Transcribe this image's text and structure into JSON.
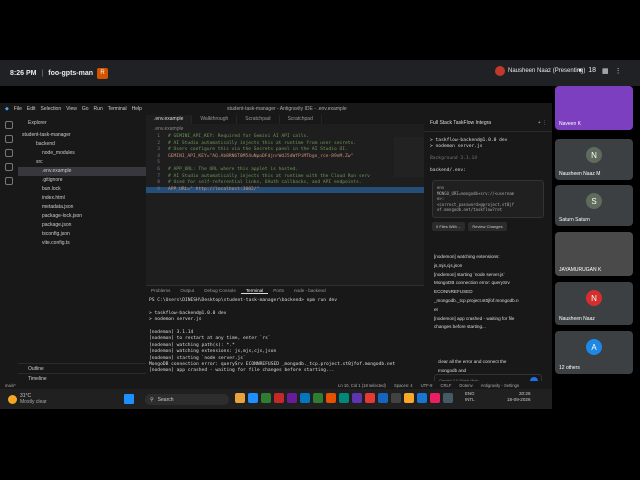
{
  "meet": {
    "time": "8:26 PM",
    "separator": "|",
    "meeting_title": "foo-gpts-man",
    "presenter_initials": "R",
    "presenter": "Nausheen Naaz (Presenting)",
    "participants_count": "18"
  },
  "ide": {
    "menu": [
      "File",
      "Edit",
      "Selection",
      "View",
      "Go",
      "Run",
      "Terminal",
      "Help"
    ],
    "window_title": "student-task-manager - Antigravity IDE - .env.example",
    "explorer_header": "Explorer",
    "project": "student-task-manager",
    "tree": [
      {
        "label": "backend",
        "level": 1,
        "selected": false
      },
      {
        "label": "node_modules",
        "level": 2,
        "selected": false
      },
      {
        "label": "src",
        "level": 1,
        "selected": false
      },
      {
        "label": ".env.example",
        "level": 2,
        "selected": true
      },
      {
        "label": ".gitignore",
        "level": 2,
        "selected": false
      },
      {
        "label": "bun.lock",
        "level": 2,
        "selected": false
      },
      {
        "label": "index.html",
        "level": 2,
        "selected": false
      },
      {
        "label": "metadata.json",
        "level": 2,
        "selected": false
      },
      {
        "label": "package-lock.json",
        "level": 2,
        "selected": false
      },
      {
        "label": "package.json",
        "level": 2,
        "selected": false
      },
      {
        "label": "tsconfig.json",
        "level": 2,
        "selected": false
      },
      {
        "label": "vite.config.ts",
        "level": 2,
        "selected": false
      }
    ],
    "outline": "Outline",
    "timeline": "Timeline",
    "tabs": [
      ".env.example",
      "Walkthrough",
      "Scratchpad",
      "Scratchpad"
    ],
    "breadcrumb": ".env.example",
    "code": [
      {
        "n": "1",
        "t": "# GEMINI_API_KEY: Required for Gemini AI API calls.",
        "c": "cm"
      },
      {
        "n": "2",
        "t": "# AI Studio automatically injects this at runtime from user secrets.",
        "c": "cm"
      },
      {
        "n": "3",
        "t": "# Users configure this via the Secrets panel in the AI Studio UI.",
        "c": "cm"
      },
      {
        "n": "4",
        "t": "GEMINI_API_KEY=\"AQ.Ab8RN6T0M54uNpoDFdjnrWdJ5dWfPiMTbgn_rce-89eM.Zw\"",
        "c": "st"
      },
      {
        "n": "5",
        "t": "",
        "c": ""
      },
      {
        "n": "6",
        "t": "# APP_URL: The URL where this applet is hosted.",
        "c": "cm"
      },
      {
        "n": "7",
        "t": "# AI Studio automatically injects this at runtime with the Cloud Run serv",
        "c": "cm"
      },
      {
        "n": "8",
        "t": "# Used for self-referential links, OAuth callbacks, and API endpoints.",
        "c": "cm"
      },
      {
        "n": "9",
        "t": "APP_URL=\" http://localhost:3002/\"",
        "c": "st"
      }
    ],
    "panel_tabs": [
      "Problems",
      "Output",
      "Debug Console",
      "Terminal",
      "Ports",
      "node - backend"
    ],
    "terminal": "PS C:\\Users\\DINESH\\Desktop\\student-task-manager\\backend> npm run dev\n\n> taskflow-backend@1.0.0 dev\n> nodemon server.js\n\n[nodemon] 3.1.14\n[nodemon] to restart at any time, enter `rs`\n[nodemon] watching path(s): *.*\n[nodemon] watching extensions: js,mjs,cjs,json\n[nodemon] starting `node server.js`\nMongoDB connection error: querySrv ECONNREFUSED _mongodb._tcp.project.st0jfof.mongodb.net\n[nodemon] app crashed - waiting for file changes before starting...",
    "status_left": "main*",
    "status_right": [
      "Ln 10, Col 1 (18 selected)",
      "Spaces: 4",
      "UTF-8",
      "CRLF",
      "Dotenv",
      "Antigravity - Settings"
    ]
  },
  "agent": {
    "title": "Full Stack TaskFlow Integra",
    "term_lines": [
      "> taskflow-backend@1.0.0 dev",
      "> nodemon server.js"
    ],
    "status_text": "Background 3.1.14",
    "cwd": "backend/.env:",
    "card_lines": [
      "env",
      "MONGO_URI=mongodb+srv://<usernam",
      "e>:",
      "<correct_password>@project.st0jf",
      "of.mongodb.net/taskflow?ret"
    ],
    "btn_files": "0 Files With ...",
    "btn_review": "Review Changes",
    "log": [
      "[nodemon] watching extensions:",
      "js,mjs,cjs,json",
      "[nodemon] starting `node server.js`",
      "MongoDB connection error: querySrv",
      "ECONNREFUSED",
      "_mongodb._tcp.project.st0jfof.mongodb.n",
      "et",
      "[nodemon] app crashed - waiting for file",
      "changes before starting..."
    ],
    "user_msg": [
      "clear all the error and connect the",
      "mongodb and"
    ],
    "model": "Gemini 3.0 Flash High"
  },
  "taskbar": {
    "temp": "31°C",
    "weather": "Mostly clear",
    "search": "Search",
    "lang": "ENG",
    "lang2": "INTL",
    "clock_time": "20:26",
    "clock_date": "18-09-2026"
  },
  "tiles": [
    {
      "name": "Naveen K",
      "bg": "#7b3fbf",
      "initial": ""
    },
    {
      "name": "Nausheen Naaz M",
      "bg": "#3c4043",
      "initial": "N"
    },
    {
      "name": "Saturn Saturn",
      "bg": "#3c4043",
      "initial": "S"
    },
    {
      "name": "JAYAMURUGAN K",
      "bg": "#4a4a4a",
      "initial": ""
    },
    {
      "name": "Nausheen Naaz",
      "bg": "#3c4043",
      "initial": "N"
    },
    {
      "name": "12 others",
      "bg": "#3c4043",
      "initial": "A"
    }
  ]
}
